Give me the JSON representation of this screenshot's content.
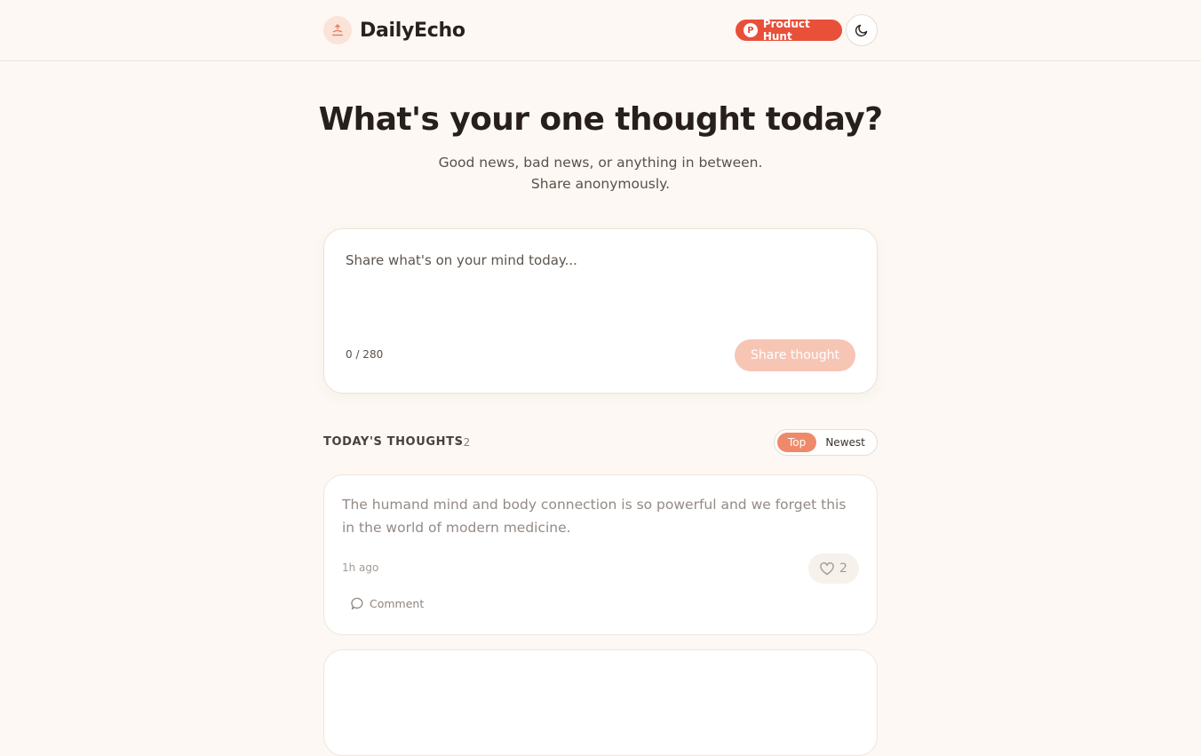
{
  "header": {
    "brand_name": "DailyEcho",
    "product_hunt_label": "Product Hunt",
    "product_hunt_logo_letter": "P",
    "theme_icon": "moon-icon",
    "colors": {
      "accent": "#ee8a6a",
      "badge": "#e8503a",
      "background": "#fdf8f3"
    }
  },
  "hero": {
    "title": "What's your one thought today?",
    "subtitle_line1": "Good news, bad news, or anything in between.",
    "subtitle_line2": "Share anonymously."
  },
  "composer": {
    "placeholder": "Share what's on your mind today...",
    "char_count": "0 / 280",
    "submit_label": "Share thought"
  },
  "feed": {
    "title": "TODAY'S THOUGHTS",
    "count": "· 2",
    "sort_options": [
      "Top",
      "Newest"
    ],
    "selected_sort": "Top",
    "posts": [
      {
        "text": "The humand mind and body connection is so powerful and we forget this in the world of modern medicine.",
        "time": "1h ago",
        "likes": "2",
        "comment_label": "Comment"
      },
      {
        "text": "",
        "time": "",
        "likes": "",
        "comment_label": ""
      }
    ]
  }
}
